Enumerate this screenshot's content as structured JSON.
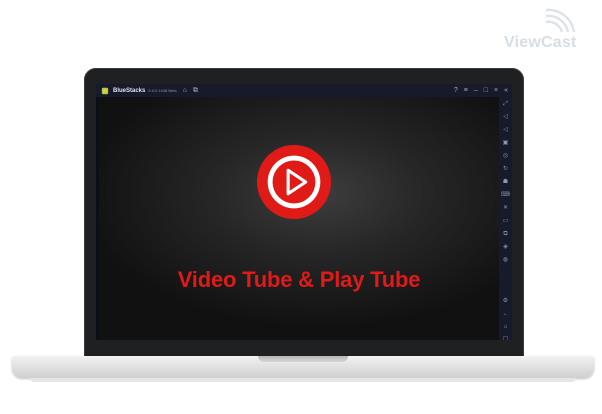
{
  "watermark": {
    "text": "ViewCast"
  },
  "emulator": {
    "title": "BlueStacks",
    "subtitle": "5.0.0.1048 Beta",
    "title_icons": [
      "home-icon",
      "multi-instance-icon"
    ],
    "window_controls": [
      "help-icon",
      "menu-icon",
      "minimize-icon",
      "maximize-icon",
      "close-icon",
      "collapse-sidebar-icon"
    ],
    "sidebar_icons": [
      "fullscreen-icon",
      "volume-up-icon",
      "volume-down-icon",
      "screen-record-icon",
      "screenshot-icon",
      "rotate-icon",
      "shake-icon",
      "keyboard-controls-icon",
      "media-manager-icon",
      "folder-icon",
      "multi-instance-manager-icon",
      "macros-icon",
      "eco-mode-icon",
      "settings-icon",
      "back-icon",
      "home-icon",
      "recent-apps-icon"
    ]
  },
  "app": {
    "name": "Video Tube & Play Tube",
    "logo_icon": "play-button-icon",
    "brand_color": "#e01a17"
  }
}
